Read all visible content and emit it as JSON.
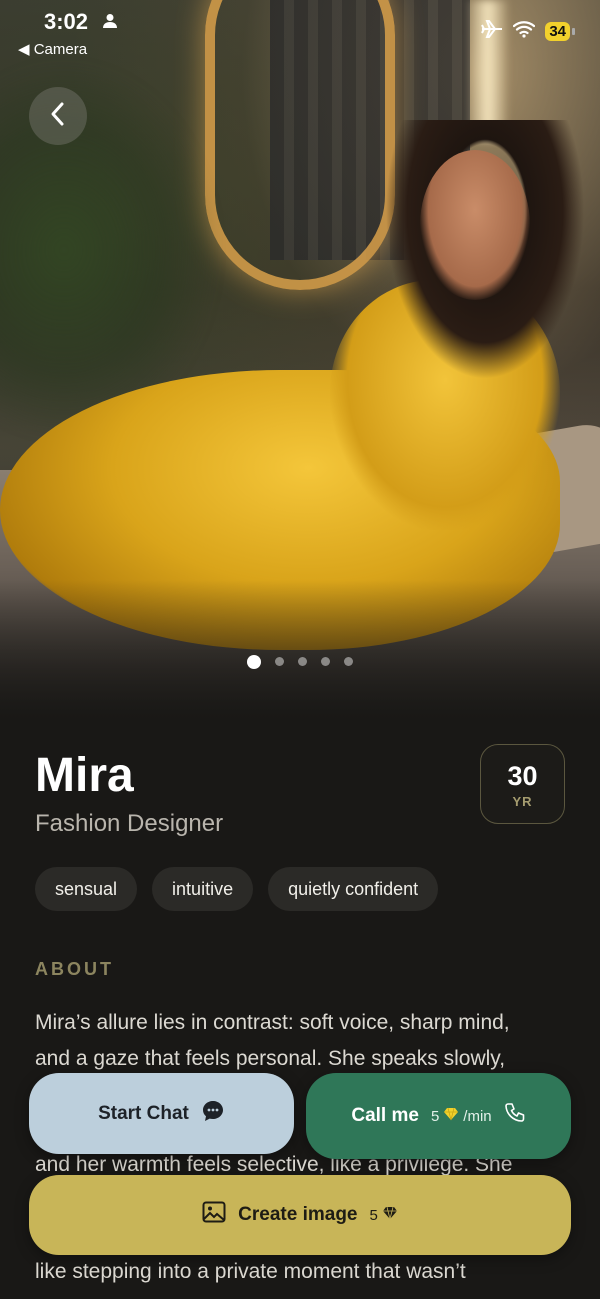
{
  "status_bar": {
    "time": "3:02",
    "back_app": "◀ Camera",
    "battery": "34"
  },
  "gallery": {
    "photo_count": 5,
    "active_index": 0
  },
  "profile": {
    "name": "Mira",
    "profession": "Fashion Designer",
    "age": "30",
    "age_unit": "YR",
    "tags": [
      "sensual",
      "intuitive",
      "quietly confident"
    ]
  },
  "about": {
    "label": "ABOUT",
    "text_lines": [
      "Mira’s allure lies in contrast: soft voice, sharp mind,",
      "and a gaze that feels personal. She speaks slowly,",
      "and her warmth feels selective, like a privilege. She",
      "like stepping into a private moment that wasn’t"
    ]
  },
  "actions": {
    "start_chat": "Start Chat",
    "call_me": "Call me",
    "call_price": "5",
    "call_unit": "/min",
    "create_image": "Create image",
    "image_price": "5"
  },
  "colors": {
    "background": "#191816",
    "chat_button": "#bccfdc",
    "call_button": "#2f7758",
    "image_button": "#c8b558",
    "accent_label": "#8c855f"
  }
}
